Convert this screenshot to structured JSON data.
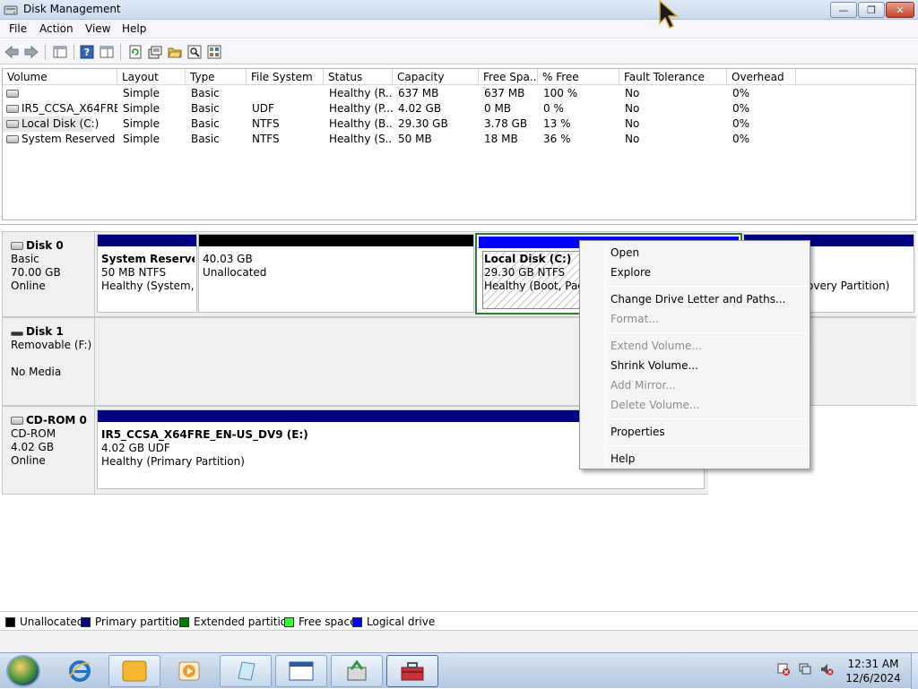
{
  "window": {
    "title": "Disk Management",
    "minimize_glyph": "—",
    "maximize_glyph": "❐",
    "close_glyph": "✕"
  },
  "menu": [
    "File",
    "Action",
    "View",
    "Help"
  ],
  "volume_table": {
    "columns": [
      "Volume",
      "Layout",
      "Type",
      "File System",
      "Status",
      "Capacity",
      "Free Spa...",
      "% Free",
      "Fault Tolerance",
      "Overhead"
    ],
    "rows": [
      {
        "volume": "",
        "layout": "Simple",
        "type": "Basic",
        "fs": "",
        "status": "Healthy (R...",
        "capacity": "637 MB",
        "free": "637 MB",
        "pct": "100 %",
        "fault": "No",
        "overhead": "0%"
      },
      {
        "volume": "IR5_CCSA_X64FRE...",
        "layout": "Simple",
        "type": "Basic",
        "fs": "UDF",
        "status": "Healthy (P...",
        "capacity": "4.02 GB",
        "free": "0 MB",
        "pct": "0 %",
        "fault": "No",
        "overhead": "0%"
      },
      {
        "volume": "Local Disk (C:)",
        "layout": "Simple",
        "type": "Basic",
        "fs": "NTFS",
        "status": "Healthy (B...",
        "capacity": "29.30 GB",
        "free": "3.78 GB",
        "pct": "13 %",
        "fault": "No",
        "overhead": "0%"
      },
      {
        "volume": "System Reserved",
        "layout": "Simple",
        "type": "Basic",
        "fs": "NTFS",
        "status": "Healthy (S...",
        "capacity": "50 MB",
        "free": "18 MB",
        "pct": "36 %",
        "fault": "No",
        "overhead": "0%"
      }
    ]
  },
  "disks": {
    "disk0": {
      "name": "Disk 0",
      "type": "Basic",
      "size": "70.00 GB",
      "state": "Online"
    },
    "disk1": {
      "name": "Disk 1",
      "type": "Removable (F:)",
      "state": "No Media"
    },
    "cdrom0": {
      "name": "CD-ROM 0",
      "type": "CD-ROM",
      "size": "4.02 GB",
      "state": "Online"
    }
  },
  "partitions": {
    "system_reserved": {
      "name": "System Reserved",
      "size": "50 MB NTFS",
      "status": "Healthy (System, A"
    },
    "unallocated": {
      "size": "40.03 GB",
      "status": "Unallocated"
    },
    "local_disk": {
      "name": "Local Disk  (C:)",
      "size": "29.30 GB NTFS",
      "status": "Healthy (Boot, Page"
    },
    "recovery": {
      "status": "overy Partition)"
    },
    "cdrom": {
      "name": "IR5_CCSA_X64FRE_EN-US_DV9  (E:)",
      "size": "4.02 GB UDF",
      "status": "Healthy (Primary Partition)"
    }
  },
  "legend": [
    {
      "label": "Unallocated",
      "color": "#000000"
    },
    {
      "label": "Primary partition",
      "color": "#000080"
    },
    {
      "label": "Extended partition",
      "color": "#008000"
    },
    {
      "label": "Free space",
      "color": "#33ff33"
    },
    {
      "label": "Logical drive",
      "color": "#0000ff"
    }
  ],
  "colors": {
    "primary": "#000080",
    "unallocated": "#000000",
    "logical": "#0000ff",
    "extended": "#008000"
  },
  "context_menu": {
    "open": "Open",
    "explore": "Explore",
    "change_letter": "Change Drive Letter and Paths...",
    "format": "Format...",
    "extend": "Extend Volume...",
    "shrink": "Shrink Volume...",
    "add_mirror": "Add Mirror...",
    "delete": "Delete Volume...",
    "properties": "Properties",
    "help": "Help"
  },
  "taskbar": {
    "time": "12:31 AM",
    "date": "12/6/2024",
    "pinned": [
      "internet-explorer",
      "libraries",
      "media-player",
      "notepad",
      "window",
      "server-manager",
      "toolbox"
    ]
  }
}
